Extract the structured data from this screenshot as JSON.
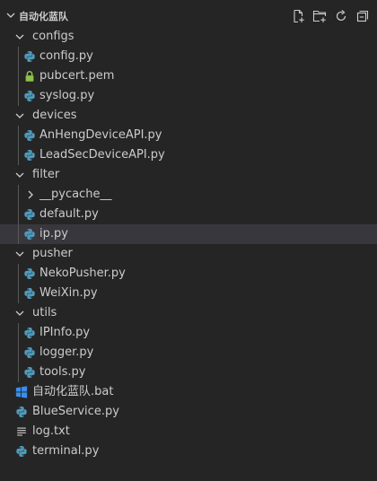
{
  "explorer": {
    "title": "自动化蓝队",
    "actions": [
      {
        "icon": "new-file-icon"
      },
      {
        "icon": "new-folder-icon"
      },
      {
        "icon": "refresh-icon"
      },
      {
        "icon": "collapse-all-icon"
      }
    ],
    "items": [
      {
        "label": "configs",
        "type": "folder",
        "expanded": true
      },
      {
        "label": "config.py",
        "type": "python"
      },
      {
        "label": "pubcert.pem",
        "type": "pem"
      },
      {
        "label": "syslog.py",
        "type": "python"
      },
      {
        "label": "devices",
        "type": "folder",
        "expanded": true
      },
      {
        "label": "AnHengDeviceAPI.py",
        "type": "python"
      },
      {
        "label": "LeadSecDeviceAPI.py",
        "type": "python"
      },
      {
        "label": "filter",
        "type": "folder",
        "expanded": true
      },
      {
        "label": "__pycache__",
        "type": "folder",
        "expanded": false
      },
      {
        "label": "default.py",
        "type": "python"
      },
      {
        "label": "ip.py",
        "type": "python",
        "selected": true
      },
      {
        "label": "pusher",
        "type": "folder",
        "expanded": true
      },
      {
        "label": "NekoPusher.py",
        "type": "python"
      },
      {
        "label": "WeiXin.py",
        "type": "python"
      },
      {
        "label": "utils",
        "type": "folder",
        "expanded": true
      },
      {
        "label": "IPInfo.py",
        "type": "python"
      },
      {
        "label": "logger.py",
        "type": "python"
      },
      {
        "label": "tools.py",
        "type": "python"
      },
      {
        "label": "自动化蓝队.bat",
        "type": "bat"
      },
      {
        "label": "BlueService.py",
        "type": "python"
      },
      {
        "label": "log.txt",
        "type": "text"
      },
      {
        "label": "terminal.py",
        "type": "python"
      }
    ]
  },
  "colors": {
    "background": "#252526",
    "selected_row": "#37373d",
    "text": "#cccccc",
    "python_icon": "#519aba",
    "pem_icon": "#8dc149",
    "bat_icon": "#3b8eea",
    "indent_guide": "#585858"
  }
}
